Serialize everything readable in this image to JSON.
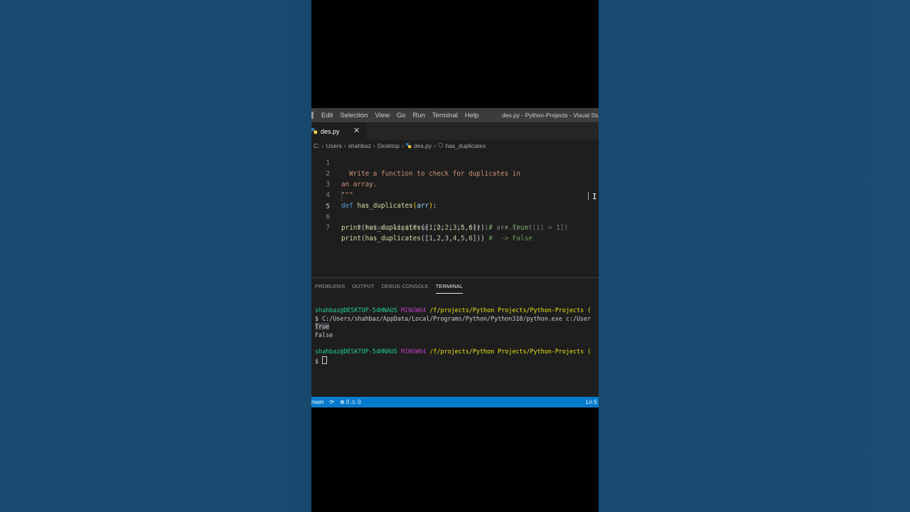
{
  "window": {
    "title": "des.py - Python-Projects - Visual Studi",
    "menu": [
      "Edit",
      "Selection",
      "View",
      "Go",
      "Run",
      "Terminal",
      "Help"
    ]
  },
  "tab": {
    "label": "des.py",
    "close": "✕"
  },
  "breadcrumb": {
    "parts": [
      "C:",
      "Users",
      "shahbaz",
      "Desktop",
      "des.py",
      "has_duplicates"
    ]
  },
  "editor": {
    "lines": [
      {
        "num": "1",
        "text": "  Write a function to check for duplicates in"
      },
      {
        "num": "2",
        "text": "an array."
      },
      {
        "num": "3",
        "text": "\"\"\""
      },
      {
        "num": "4",
        "text": "def has_duplicates(arr):"
      },
      {
        "num": "5",
        "text": "    # return any([True for i in arr if arr.count(i) > 1])"
      },
      {
        "num": "6",
        "text": "print(has_duplicates([1,2,2,3,5,6])) #  -> True"
      },
      {
        "num": "7",
        "text": "print(has_duplicates([1,2,3,4,5,6])) #  -> False"
      }
    ]
  },
  "panel": {
    "tabs": [
      "PROBLEMS",
      "OUTPUT",
      "DEBUG CONSOLE",
      "TERMINAL"
    ],
    "active_tab": "TERMINAL"
  },
  "terminal": {
    "user": "shahbaz@DESKTOP-54HNAUS",
    "mingw": "MINGW64",
    "path": "/f/projects/Python Projects/Python-Projects (",
    "command": "$ C:/Users/shahbaz/AppData/Local/Programs/Python/Python310/python.exe c:/User",
    "output1": "True",
    "output2": "False",
    "prompt": "$ "
  },
  "statusbar": {
    "branch": "main",
    "sync_icon": "sync-icon",
    "errors": "0",
    "warnings": "0",
    "position": "Ln 5"
  }
}
